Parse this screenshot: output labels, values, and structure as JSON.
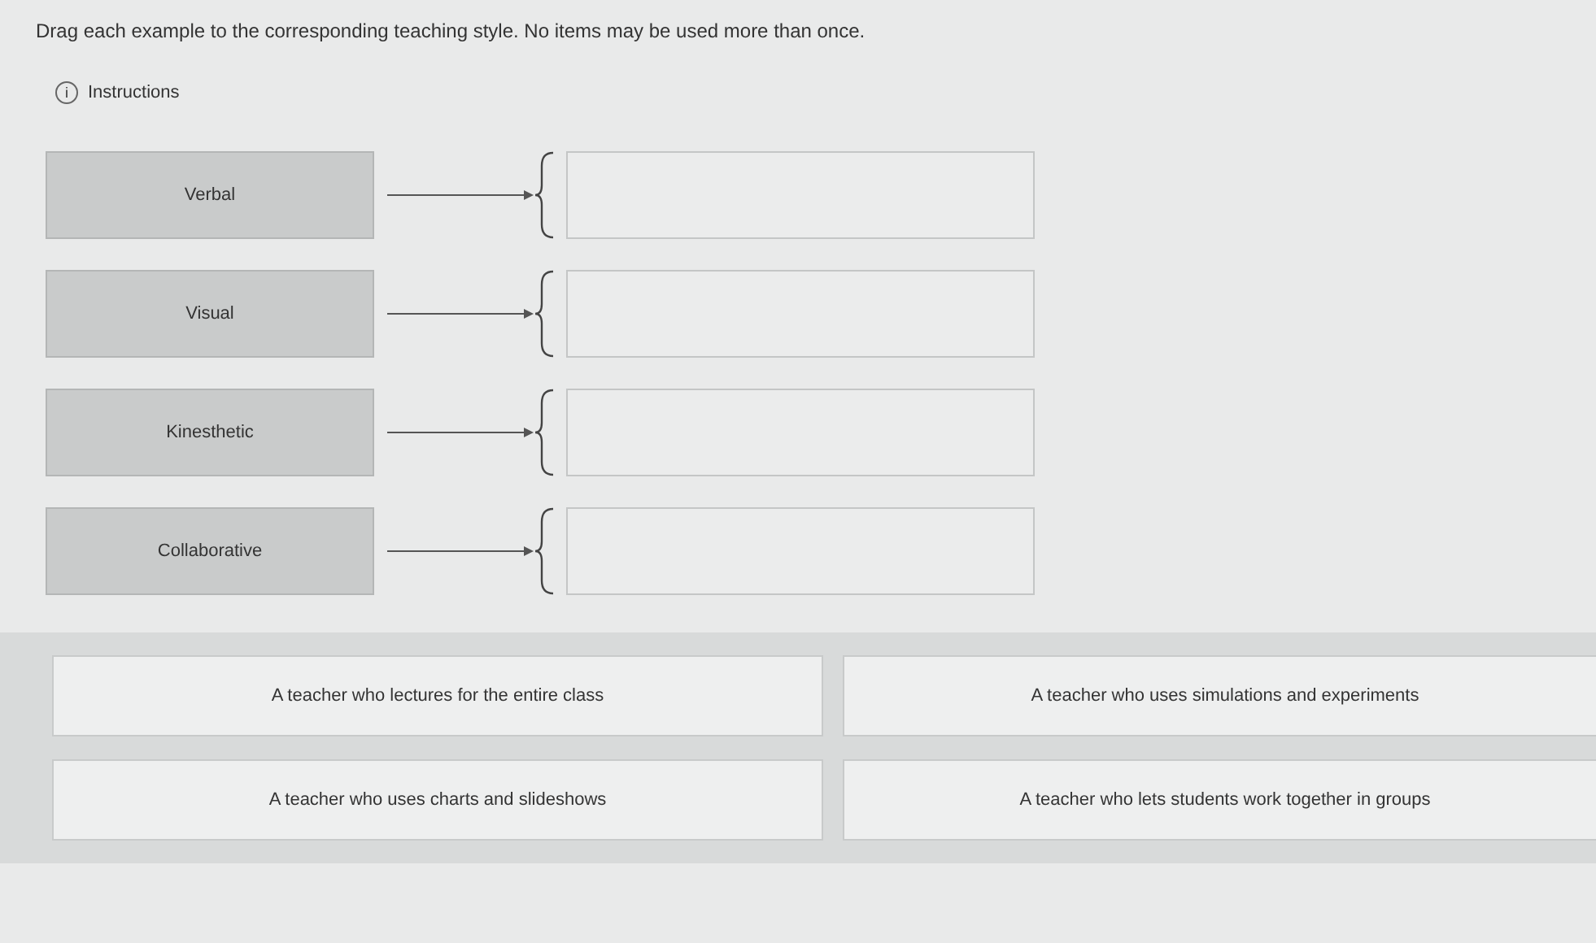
{
  "prompt": "Drag each example to the corresponding teaching style. No items may be used more than once.",
  "instructions": {
    "icon": "i",
    "label": "Instructions"
  },
  "styles": [
    {
      "label": "Verbal"
    },
    {
      "label": "Visual"
    },
    {
      "label": "Kinesthetic"
    },
    {
      "label": "Collaborative"
    }
  ],
  "examples": [
    "A teacher who lectures for the entire class",
    "A teacher who uses simulations and experiments",
    "A teacher who uses charts and slideshows",
    "A teacher who lets students work together in groups"
  ]
}
